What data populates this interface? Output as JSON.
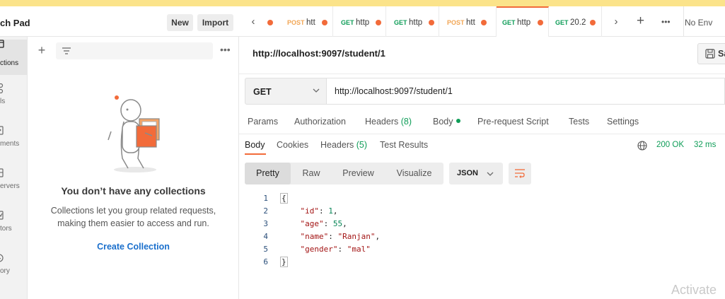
{
  "workspace": {
    "title": "ch Pad",
    "new_label": "New",
    "import_label": "Import"
  },
  "rail": {
    "items": [
      {
        "label": "ctions",
        "icon": "collections-icon"
      },
      {
        "label": "ls",
        "icon": "apis-icon"
      },
      {
        "label": "ments",
        "icon": "environments-icon"
      },
      {
        "label": "ervers",
        "icon": "mock-servers-icon"
      },
      {
        "label": "tors",
        "icon": "monitors-icon"
      },
      {
        "label": "ory",
        "icon": "history-icon"
      }
    ]
  },
  "collections": {
    "empty_title": "You don’t have any collections",
    "empty_desc_line1": "Collections let you group related requests,",
    "empty_desc_line2": "making them easier to access and run.",
    "create_link": "Create Collection"
  },
  "tabs": [
    {
      "method": "POST",
      "label": "htt",
      "method_color": "#f2a654"
    },
    {
      "method": "GET",
      "label": "http",
      "method_color": "#0f9d58"
    },
    {
      "method": "GET",
      "label": "http",
      "method_color": "#0f9d58"
    },
    {
      "method": "POST",
      "label": "htt",
      "method_color": "#f2a654"
    },
    {
      "method": "GET",
      "label": "http",
      "method_color": "#0f9d58",
      "active": true
    },
    {
      "method": "GET",
      "label": "20.2",
      "method_color": "#0f9d58"
    }
  ],
  "environment": {
    "label": "No Env"
  },
  "request": {
    "title": "http://localhost:9097/student/1",
    "method": "GET",
    "url": "http://localhost:9097/student/1",
    "save_label": "Sa"
  },
  "request_tabs": {
    "params": "Params",
    "authorization": "Authorization",
    "headers": "Headers",
    "headers_count": "(8)",
    "body": "Body",
    "pre_request": "Pre-request Script",
    "tests": "Tests",
    "settings": "Settings"
  },
  "response_tabs": {
    "body": "Body",
    "cookies": "Cookies",
    "headers": "Headers",
    "headers_count": "(5)",
    "test_results": "Test Results",
    "status": "200 OK",
    "time": "32 ms"
  },
  "view_modes": {
    "pretty": "Pretty",
    "raw": "Raw",
    "preview": "Preview",
    "visualize": "Visualize",
    "format": "JSON"
  },
  "response_body": {
    "line_numbers": [
      "1",
      "2",
      "3",
      "4",
      "5",
      "6"
    ],
    "id_key": "\"id\"",
    "id_val": "1",
    "age_key": "\"age\"",
    "age_val": "55",
    "name_key": "\"name\"",
    "name_val": "\"Ranjan\"",
    "gender_key": "\"gender\"",
    "gender_val": "\"mal\""
  },
  "watermark": "Activate",
  "colors": {
    "accent": "#f26b3a",
    "success": "#0f9d58",
    "link": "#1a6fcc"
  }
}
